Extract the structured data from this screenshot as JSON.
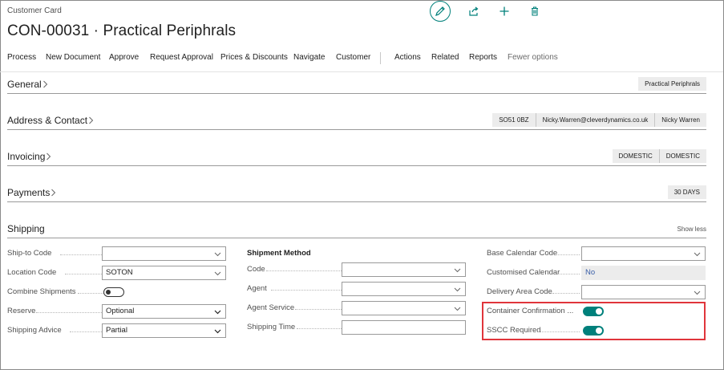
{
  "header": {
    "page_type": "Customer Card",
    "title": "CON-00031 · Practical Periphrals"
  },
  "top_actions": {
    "edit_icon": "pencil-icon",
    "share_icon": "share-icon",
    "add_icon": "plus-icon",
    "delete_icon": "trash-icon"
  },
  "menu": {
    "items": [
      "Process",
      "New Document",
      "Approve",
      "Request Approval",
      "Prices & Discounts",
      "Navigate",
      "Customer"
    ],
    "secondary": [
      "Actions",
      "Related",
      "Reports"
    ],
    "fewer": "Fewer options"
  },
  "fasttabs": {
    "general": {
      "label": "General",
      "chips": [
        "Practical Periphrals"
      ]
    },
    "address": {
      "label": "Address & Contact",
      "chips": [
        "SO51 0BZ",
        "Nicky.Warren@cleverdynamics.co.uk",
        "Nicky Warren"
      ]
    },
    "invoicing": {
      "label": "Invoicing",
      "chips": [
        "DOMESTIC",
        "DOMESTIC"
      ]
    },
    "payments": {
      "label": "Payments",
      "chips": [
        "30 DAYS"
      ]
    },
    "shipping": {
      "label": "Shipping",
      "show_less": "Show less"
    }
  },
  "shipping": {
    "col1": {
      "ship_to_code": {
        "label": "Ship-to Code",
        "value": ""
      },
      "location_code": {
        "label": "Location Code",
        "value": "SOTON"
      },
      "combine_shipments": {
        "label": "Combine Shipments",
        "on": false
      },
      "reserve": {
        "label": "Reserve",
        "value": "Optional"
      },
      "shipping_advice": {
        "label": "Shipping Advice",
        "value": "Partial"
      }
    },
    "col2": {
      "section_label": "Shipment Method",
      "code": {
        "label": "Code",
        "value": ""
      },
      "agent": {
        "label": "Agent",
        "value": ""
      },
      "agent_service": {
        "label": "Agent Service",
        "value": ""
      },
      "shipping_time": {
        "label": "Shipping Time",
        "value": ""
      }
    },
    "col3": {
      "base_calendar_code": {
        "label": "Base Calendar Code",
        "value": ""
      },
      "customised_calendar": {
        "label": "Customised Calendar",
        "value": "No"
      },
      "delivery_area_code": {
        "label": "Delivery Area Code",
        "value": ""
      },
      "container_confirmation": {
        "label": "Container Confirmation ...",
        "on": true
      },
      "sscc_required": {
        "label": "SSCC Required",
        "on": true
      }
    }
  },
  "colors": {
    "accent": "#00807b",
    "highlight": "#e0353b"
  }
}
